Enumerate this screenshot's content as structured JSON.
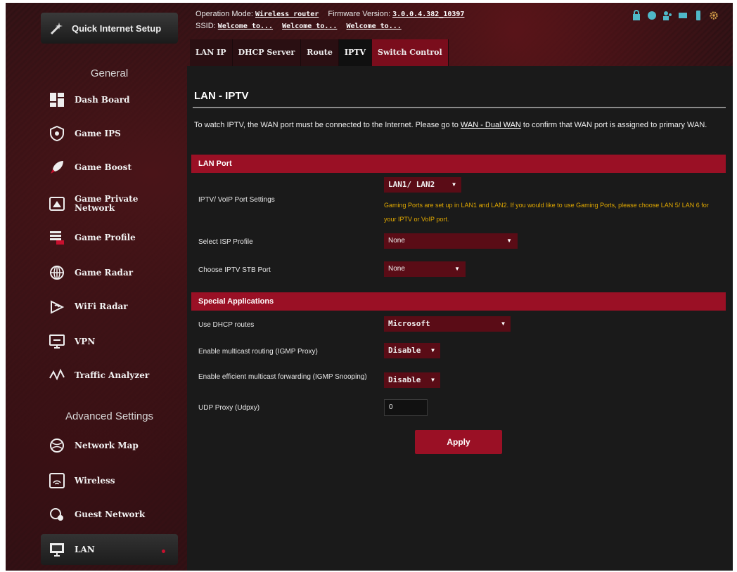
{
  "sidebar": {
    "qis_label": "Quick Internet Setup",
    "general_heading": "General",
    "general_items": [
      "Dash Board",
      "Game IPS",
      "Game Boost",
      "Game Private Network",
      "Game Profile",
      "Game Radar",
      "WiFi Radar",
      "VPN",
      "Traffic Analyzer"
    ],
    "advanced_heading": "Advanced Settings",
    "advanced_items": [
      "Network Map",
      "Wireless",
      "Guest Network",
      "LAN"
    ],
    "active_item": "LAN"
  },
  "topbar": {
    "op_mode_label": "Operation Mode:",
    "op_mode_value": "Wireless router",
    "firmware_label": "Firmware Version:",
    "firmware_value": "3.0.0.4.382_10397",
    "ssid_label": "SSID:",
    "ssid_values": [
      "Welcome to...",
      "Welcome to...",
      "Welcome to..."
    ]
  },
  "tabs": [
    "LAN IP",
    "DHCP Server",
    "Route",
    "IPTV",
    "Switch Control"
  ],
  "active_tab": "IPTV",
  "page": {
    "title": "LAN - IPTV",
    "desc_pre": "To watch IPTV, the WAN port must be connected to the Internet. Please go to ",
    "desc_link": "WAN - Dual WAN",
    "desc_post": " to confirm that WAN port is assigned to primary WAN."
  },
  "lan_port": {
    "section_title": "LAN Port",
    "iptv_voip_label": "IPTV/ VoIP Port Settings",
    "iptv_voip_value": "LAN1/ LAN2",
    "iptv_voip_hint": "Gaming Ports are set up in LAN1 and LAN2. If you would like to use Gaming Ports, please choose LAN 5/ LAN 6 for your IPTV or VoIP port.",
    "isp_profile_label": "Select ISP Profile",
    "isp_profile_value": "None",
    "stb_port_label": "Choose IPTV STB Port",
    "stb_port_value": "None"
  },
  "special": {
    "section_title": "Special Applications",
    "dhcp_routes_label": "Use DHCP routes",
    "dhcp_routes_value": "Microsoft",
    "igmp_proxy_label": "Enable multicast routing (IGMP Proxy)",
    "igmp_proxy_value": "Disable",
    "igmp_snoop_label": "Enable efficient multicast forwarding (IGMP Snooping)",
    "igmp_snoop_value": "Disable",
    "udpxy_label": "UDP Proxy (Udpxy)",
    "udpxy_value": "0"
  },
  "apply_label": "Apply",
  "colors": {
    "accent": "#9a1025",
    "hint": "#e0a800",
    "panel": "#1a1a1a"
  }
}
